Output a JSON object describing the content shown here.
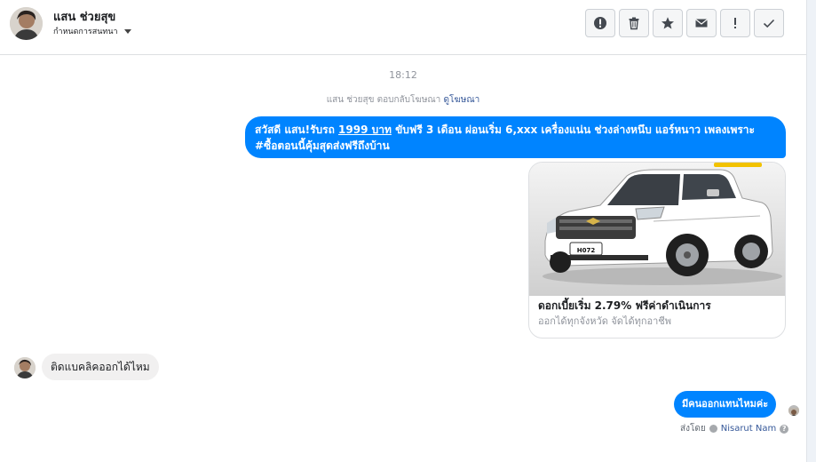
{
  "header": {
    "contact_name": "แสน ช่วยสุข",
    "assign_label": "กำหนดการสนทนา",
    "tools": [
      {
        "name": "spam-button",
        "icon": "alert-circle-icon"
      },
      {
        "name": "delete-button",
        "icon": "trash-icon"
      },
      {
        "name": "star-button",
        "icon": "star-icon"
      },
      {
        "name": "mark-unread-button",
        "icon": "envelope-icon"
      },
      {
        "name": "follow-up-button",
        "icon": "exclamation-icon"
      },
      {
        "name": "done-button",
        "icon": "check-icon"
      }
    ]
  },
  "thread": {
    "timestamp": "18:12",
    "reply_note": "แสน ช่วยสุข ตอบกลับโฆษณา",
    "reply_note_link": "ดูโฆษณา",
    "message1": {
      "part1": "สวัสดี แสน!รับรถ ",
      "link": "1999 บาท",
      "part2": " ขับฟรี 3 เดือน ผ่อนเริ่ม 6,xxx   เครื่องแน่น ช่วงล่างหนึบ แอร์หนาว เพลงเพราะ #ซื้อตอนนี้คุ้มสุดส่งฟรีถึงบ้าน"
    },
    "card": {
      "plate": "H072",
      "title": "ดอกเบี้ยเริ่ม 2.79% ฟรีค่าดำเนินการ",
      "subtitle": "ออกได้ทุกจังหวัด จัดได้ทุกอาชีพ"
    },
    "message2": "ติดแบคลิคออกได้ไหม",
    "message3": "มีคนออกแทนไหมค่ะ",
    "sent_by_label": "ส่งโดย",
    "sender_name": "Nisarut Nam",
    "help_glyph": "?"
  },
  "colors": {
    "bubble_blue": "#0084ff",
    "bubble_gray": "#f1f0f0",
    "link": "#365899",
    "muted": "#90949c"
  }
}
